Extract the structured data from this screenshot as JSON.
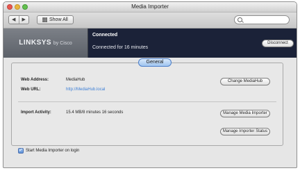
{
  "window": {
    "title": "Media Importer"
  },
  "toolbar": {
    "back_glyph": "◀",
    "forward_glyph": "▶",
    "show_all_label": "Show All",
    "search": {
      "placeholder": "",
      "value": ""
    }
  },
  "banner": {
    "brand_main": "LINKSYS",
    "brand_sub": "by Cisco",
    "status_title": "Connected",
    "status_detail": "Connected for 16 minutes",
    "disconnect_label": "Disconnect"
  },
  "tabs": {
    "general_label": "General"
  },
  "general": {
    "web_address_label": "Web Address:",
    "web_address_value": "MediaHub",
    "web_url_label": "Web URL:",
    "web_url_value": "http://MediaHub.local",
    "change_button_label": "Change MediaHub",
    "import_activity_label": "Import Activity:",
    "import_activity_value": "15.4 MB/8 minutes 16 seconds",
    "manage_button_label": "Manage Media Importer",
    "import_status_button_label": "Manage Importer Status",
    "start_login_checkbox": {
      "label": "Start Media Importer on login",
      "checked": true,
      "check_glyph": "✓"
    }
  },
  "colors": {
    "banner_bg": "#1b2238",
    "link": "#3d7fd6",
    "accent_blue": "#5b8fd8"
  },
  "icons": [
    "back-arrow-icon",
    "forward-arrow-icon",
    "show-all-grid-icon",
    "search-icon",
    "checkmark-icon"
  ]
}
